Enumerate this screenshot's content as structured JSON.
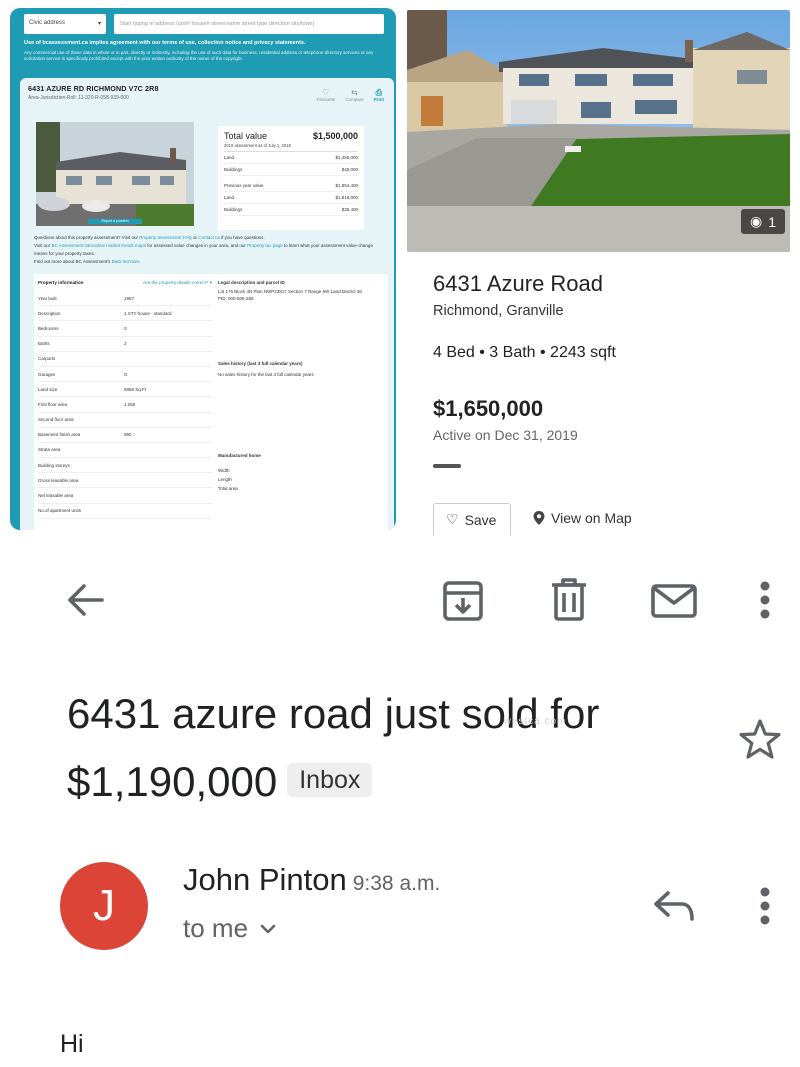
{
  "assessment": {
    "search": {
      "type_value": "Civic address",
      "placeholder": "Start typing in address (unit# house# street name street type direction city/town)"
    },
    "terms_line": "Use of bcassessment.ca implies agreement with our terms of use, collection notice and privacy statements.",
    "terms_detail": "Any commercial use of these data in whole or in part, directly or indirectly, including the use of such data for business, residential address or telephone directory services or any solicitation service is specifically prohibited except with the prior written authority of the owner of the copyright.",
    "address": "6431 AZURE RD RICHMOND V7C 2R8",
    "jurisdiction": "Area-Jurisdiction-Roll: 11-320-R-058-939-000",
    "actions": {
      "favourite": "Favourite",
      "compare": "Compare",
      "print": "Print"
    },
    "photo_caption": "Report a problem",
    "values": {
      "total_label": "Total value",
      "total_value": "$1,500,000",
      "asof": "2019 assessment as of July 1, 2018",
      "land_label": "Land",
      "land_value": "$1,455,000",
      "buildings_label": "Buildings",
      "buildings_value": "$45,000",
      "prev_label": "Previous year value",
      "prev_value": "$1,854,400",
      "prev_land_label": "Land",
      "prev_land_value": "$1,818,000",
      "prev_buildings_label": "Buildings",
      "prev_buildings_value": "$36,400"
    },
    "questions": {
      "q1_text": "Questions about this property assessment? Visit our",
      "q1_link1": "Property assessment FAQ",
      "q1_or": "or",
      "q1_link2": "Contact us",
      "q1_end": "if you have questions.",
      "q2_text": "Visit our",
      "q2_link1": "BC Assessment interactive market trends maps",
      "q2_mid": "for assessed value changes in your area, and our",
      "q2_link2": "Property tax page",
      "q2_end": "to learn what your assessment value change means for your property taxes.",
      "q3_text": "Find out more about BC Assessment's",
      "q3_link": "Data Services"
    },
    "property_info": {
      "heading": "Property information",
      "correct_link": "Are the property details correct? ▾",
      "rows": [
        {
          "label": "Year built",
          "value": "1967"
        },
        {
          "label": "Description",
          "value": "1 STY house - standard"
        },
        {
          "label": "Bedrooms",
          "value": "3"
        },
        {
          "label": "Baths",
          "value": "2"
        },
        {
          "label": "Carports",
          "value": ""
        },
        {
          "label": "Garages",
          "value": "G"
        },
        {
          "label": "Land size",
          "value": "6966 Sq Ft"
        },
        {
          "label": "First floor area",
          "value": "1,260"
        },
        {
          "label": "Second floor area",
          "value": ""
        },
        {
          "label": "Basement finish area",
          "value": "990"
        },
        {
          "label": "Strata area",
          "value": ""
        },
        {
          "label": "Building storeys",
          "value": ""
        },
        {
          "label": "Gross leasable area",
          "value": ""
        },
        {
          "label": "Net leasable area",
          "value": ""
        },
        {
          "label": "No.of apartment units",
          "value": ""
        }
      ]
    },
    "legal": {
      "heading": "Legal description and parcel ID",
      "description": "Lot 176 Block 4N Plan NWP23817 Section 7 Range 6W Land District 36",
      "pid": "PID: 000-508-268"
    },
    "sales": {
      "heading": "Sales history (last 3 full calendar years)",
      "text": "No sales history for the last 3 full calendar years"
    },
    "manufactured": {
      "heading": "Manufactured home",
      "width_label": "Width",
      "length_label": "Length",
      "total_label": "Total area"
    }
  },
  "listing": {
    "photo_count": "1",
    "title": "6431 Azure Road",
    "subtitle": "Richmond, Granville",
    "specs": "4 Bed • 3 Bath • 2243 sqft",
    "price": "$1,650,000",
    "status": "Active on Dec 31, 2019",
    "save_label": "Save",
    "map_label": "View on Map"
  },
  "email": {
    "subject": "6431 azure road just sold for $1,190,000",
    "label": "Inbox",
    "avatar_letter": "J",
    "sender": "John Pinton",
    "time": "9:38 a.m.",
    "recipient": "to me",
    "body": "Hi",
    "watermark": "westca.com"
  },
  "colors": {
    "bca_teal": "#1f9bb3",
    "avatar_red": "#db4437",
    "lawn_green": "#3f7a22"
  }
}
